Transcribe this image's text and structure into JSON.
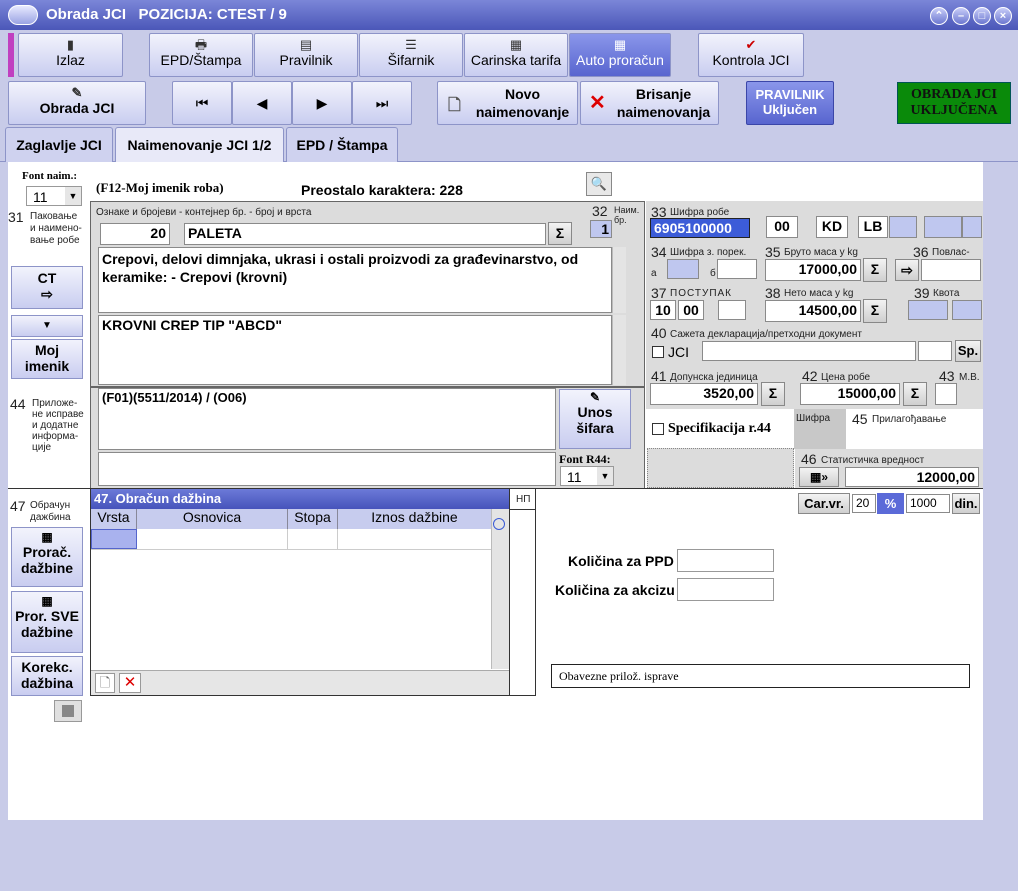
{
  "window": {
    "title": "Obrada JCI",
    "position_label": "POZICIJA: CTEST / 9"
  },
  "toolbar1": [
    {
      "label": "Izlaz",
      "icon": "door-icon"
    },
    {
      "label": "EPD/Štampa",
      "icon": "printer-icon"
    },
    {
      "label": "Pravilnik",
      "icon": "book-icon"
    },
    {
      "label": "Šifarnik",
      "icon": "list-icon"
    },
    {
      "label": "Carinska tarifa",
      "icon": "tariff-icon"
    },
    {
      "label": "Auto proračun",
      "icon": "calculator-icon"
    },
    {
      "label": "Kontrola JCI",
      "icon": "checkmark-icon"
    }
  ],
  "toolbar2": {
    "obrada": "Obrada JCI",
    "novo_l1": "Novo",
    "novo_l2": "naimenovanje",
    "brisanje_l1": "Brisanje",
    "brisanje_l2": "naimenovanja",
    "pravilnik_l1": "PRAVILNIK",
    "pravilnik_l2": "Uključen",
    "status_l1": "OBRADA JCI",
    "status_l2": "UKLJUČENA"
  },
  "tabs": [
    "Zaglavlje JCI",
    "Naimenovanje JCI 1/2",
    "EPD / Štampa"
  ],
  "left": {
    "font_label": "Font naim.:",
    "font_value": "11",
    "f31_num": "31",
    "f31_l1": "Пакoвање",
    "f31_l2": "и наимено-",
    "f31_l3": "вање робе",
    "ct": "CT",
    "moj_l1": "Moj",
    "moj_l2": "imenik",
    "f44_num": "44",
    "f44_l1": "Приложе-",
    "f44_l2": "не исправе",
    "f44_l3": "и додатне",
    "f44_l4": "информа-",
    "f44_l5": "ције",
    "f47_num": "47",
    "f47_l1": "Обрачун",
    "f47_l2": "дажбина",
    "prorac_l1": "Prorač.",
    "prorac_l2": "dažbine",
    "prorsve_l1": "Pror. SVE",
    "prorsve_l2": "dažbine",
    "korekc_l1": "Korekc.",
    "korekc_l2": "dažbina"
  },
  "goods": {
    "imenik_hint": "(F12-Moj imenik roba)",
    "preostalo": "Preostalo karaktera: 228",
    "oznake_label": "Ознаке и бројеви - контејнер бр. - број и врста",
    "qty": "20",
    "pack": "PALETA",
    "desc1": "Crepovi, delovi dimnjaka, ukrasi i ostali proizvodi za građevinarstvo, od keramike: - Crepovi (krovni)",
    "desc2": "KROVNI CREP TIP \"ABCD\"",
    "f32_num": "32",
    "f32_l1": "Наим.",
    "f32_l2": "бр.",
    "f32_value": "1",
    "f44_value": "(F01)(5511/2014) / (O06)",
    "unos_l1": "Unos",
    "unos_l2": "šifara",
    "font_r44_label": "Font R44:",
    "font_r44_value": "11"
  },
  "right": {
    "f33_num": "33",
    "f33_label": "Шифра робе",
    "f33_value": "6905100000",
    "f33_b": "00",
    "f33_c": "KD",
    "f33_d": "LB",
    "f34_num": "34",
    "f34_label": "Шифра з. порек.",
    "f34_a": "a",
    "f34_b": "б",
    "f35_num": "35",
    "f35_label": "Бруто маса у kg",
    "f35_value": "17000,00",
    "f36_num": "36",
    "f36_label": "Повлас-",
    "f37_num": "37",
    "f37_label": "ПОСТУПАК",
    "f37_a": "10",
    "f37_b": "00",
    "f38_num": "38",
    "f38_label": "Нето маса у kg",
    "f38_value": "14500,00",
    "f39_num": "39",
    "f39_label": "Квота",
    "f40_num": "40",
    "f40_label": "Сажета декларација/претходни документ",
    "f40_jci": "JCI",
    "f40_sp": "Sp.",
    "f41_num": "41",
    "f41_label": "Допунска јединица",
    "f41_value": "3520,00",
    "f42_num": "42",
    "f42_label": "Цена робе",
    "f42_value": "15000,00",
    "f43_num": "43",
    "f43_label": "М.В.",
    "specifikacija": "Specifikacija r.44",
    "sifra_label": "Шифра",
    "f45_num": "45",
    "f45_label": "Прилагођавање",
    "f46_num": "46",
    "f46_label": "Статистичка вредност",
    "f46_value": "12000,00",
    "sigma": "Σ",
    "carvr": "Car.vr.",
    "carvr_a": "20",
    "carvr_pct": "%",
    "carvr_b": "1000",
    "carvr_din": "din."
  },
  "duties": {
    "title": "47. Obračun dažbina",
    "np": "НП",
    "cols": [
      "Vrsta",
      "Osnovica",
      "Stopa",
      "Iznos dažbine"
    ]
  },
  "extra": {
    "kol_ppd": "Količina za PPD",
    "kol_akciz": "Količina za akcizu",
    "obavezne": "Obavezne prilož. isprave"
  }
}
